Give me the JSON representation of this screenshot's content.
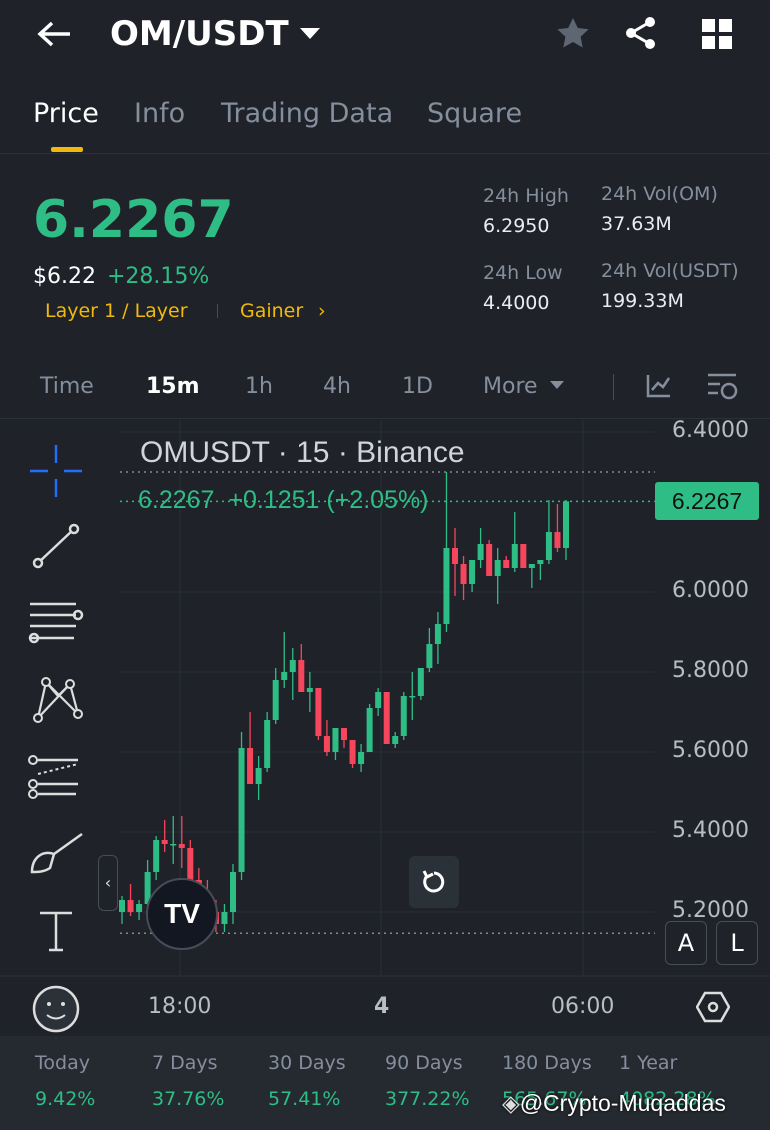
{
  "header": {
    "title": "OM/USDT",
    "back_icon": "arrow-left-icon",
    "star_icon": "star-icon",
    "share_icon": "share-icon",
    "grid_icon": "grid-icon"
  },
  "tabs": [
    "Price",
    "Info",
    "Trading Data",
    "Square"
  ],
  "ticker": {
    "price": "6.2267",
    "usd": "$6.22",
    "change": "+28.15%",
    "tag1": "Layer 1 / Layer",
    "tag2": "Gainer",
    "high_label": "24h High",
    "high": "6.2950",
    "low_label": "24h Low",
    "low": "4.4000",
    "vol_om_label": "24h Vol(OM)",
    "vol_om": "37.63M",
    "vol_usdt_label": "24h Vol(USDT)",
    "vol_usdt": "199.33M"
  },
  "timeframes": [
    "Time",
    "15m",
    "1h",
    "4h",
    "1D",
    "More"
  ],
  "chart_data": {
    "type": "candlestick",
    "title": "OMUSDT · 15 · Binance",
    "legend": "6.2267  +0.1251 (+2.05%)",
    "last_price": "6.2267",
    "y_ticks": [
      "6.4000",
      "6.0000",
      "5.8000",
      "5.6000",
      "5.4000",
      "5.2000"
    ],
    "y_tick_values": [
      6.4,
      6.0,
      5.8,
      5.6,
      5.4,
      5.2
    ],
    "ylim": [
      5.13,
      6.42
    ],
    "x_ticks": [
      "18:00",
      "4",
      "06:00"
    ],
    "candles": [
      [
        5.2,
        5.24,
        5.17,
        5.23
      ],
      [
        5.23,
        5.27,
        5.19,
        5.2
      ],
      [
        5.2,
        5.23,
        5.18,
        5.22
      ],
      [
        5.22,
        5.33,
        5.21,
        5.3
      ],
      [
        5.3,
        5.39,
        5.28,
        5.38
      ],
      [
        5.38,
        5.43,
        5.35,
        5.37
      ],
      [
        5.37,
        5.44,
        5.32,
        5.37
      ],
      [
        5.37,
        5.44,
        5.31,
        5.36
      ],
      [
        5.36,
        5.38,
        5.27,
        5.28
      ],
      [
        5.28,
        5.31,
        5.2,
        5.25
      ],
      [
        5.25,
        5.28,
        5.18,
        5.2
      ],
      [
        5.2,
        5.23,
        5.15,
        5.17
      ],
      [
        5.17,
        5.22,
        5.15,
        5.2
      ],
      [
        5.2,
        5.32,
        5.17,
        5.3
      ],
      [
        5.3,
        5.65,
        5.28,
        5.61
      ],
      [
        5.61,
        5.7,
        5.52,
        5.52
      ],
      [
        5.52,
        5.59,
        5.48,
        5.56
      ],
      [
        5.56,
        5.7,
        5.55,
        5.68
      ],
      [
        5.68,
        5.81,
        5.67,
        5.78
      ],
      [
        5.78,
        5.9,
        5.76,
        5.8
      ],
      [
        5.8,
        5.86,
        5.73,
        5.83
      ],
      [
        5.83,
        5.87,
        5.75,
        5.75
      ],
      [
        5.75,
        5.8,
        5.7,
        5.76
      ],
      [
        5.76,
        5.76,
        5.63,
        5.64
      ],
      [
        5.64,
        5.68,
        5.59,
        5.6
      ],
      [
        5.6,
        5.66,
        5.58,
        5.66
      ],
      [
        5.66,
        5.66,
        5.61,
        5.63
      ],
      [
        5.63,
        5.63,
        5.56,
        5.57
      ],
      [
        5.57,
        5.62,
        5.55,
        5.6
      ],
      [
        5.6,
        5.72,
        5.6,
        5.71
      ],
      [
        5.71,
        5.76,
        5.69,
        5.75
      ],
      [
        5.75,
        5.75,
        5.62,
        5.62
      ],
      [
        5.62,
        5.65,
        5.61,
        5.64
      ],
      [
        5.64,
        5.75,
        5.63,
        5.74
      ],
      [
        5.74,
        5.8,
        5.68,
        5.74
      ],
      [
        5.74,
        5.81,
        5.73,
        5.81
      ],
      [
        5.81,
        5.91,
        5.8,
        5.87
      ],
      [
        5.87,
        5.95,
        5.82,
        5.92
      ],
      [
        5.92,
        6.3,
        5.9,
        6.11
      ],
      [
        6.11,
        6.16,
        5.99,
        6.07
      ],
      [
        6.07,
        6.09,
        5.98,
        6.02
      ],
      [
        6.02,
        6.08,
        6.0,
        6.08
      ],
      [
        6.08,
        6.16,
        6.06,
        6.12
      ],
      [
        6.12,
        6.13,
        6.04,
        6.04
      ],
      [
        6.04,
        6.11,
        5.97,
        6.08
      ],
      [
        6.08,
        6.09,
        6.06,
        6.06
      ],
      [
        6.06,
        6.2,
        6.05,
        6.12
      ],
      [
        6.12,
        6.12,
        6.06,
        6.06
      ],
      [
        6.06,
        6.07,
        6.01,
        6.07
      ],
      [
        6.07,
        6.08,
        6.03,
        6.08
      ],
      [
        6.08,
        6.23,
        6.07,
        6.15
      ],
      [
        6.15,
        6.22,
        6.1,
        6.11
      ],
      [
        6.11,
        6.23,
        6.08,
        6.2267
      ]
    ],
    "up_color": "#2ebd85",
    "down_color": "#f6465d"
  },
  "chart_buttons": {
    "auto": "A",
    "log": "L"
  },
  "performance": [
    {
      "label": "Today",
      "value": "9.42%"
    },
    {
      "label": "7 Days",
      "value": "37.76%"
    },
    {
      "label": "30 Days",
      "value": "57.41%"
    },
    {
      "label": "90 Days",
      "value": "377.22%"
    },
    {
      "label": "180 Days",
      "value": "565.67%"
    },
    {
      "label": "1 Year",
      "value": "4082.28%"
    }
  ],
  "watermark": "@Crypto-Muqaddas"
}
